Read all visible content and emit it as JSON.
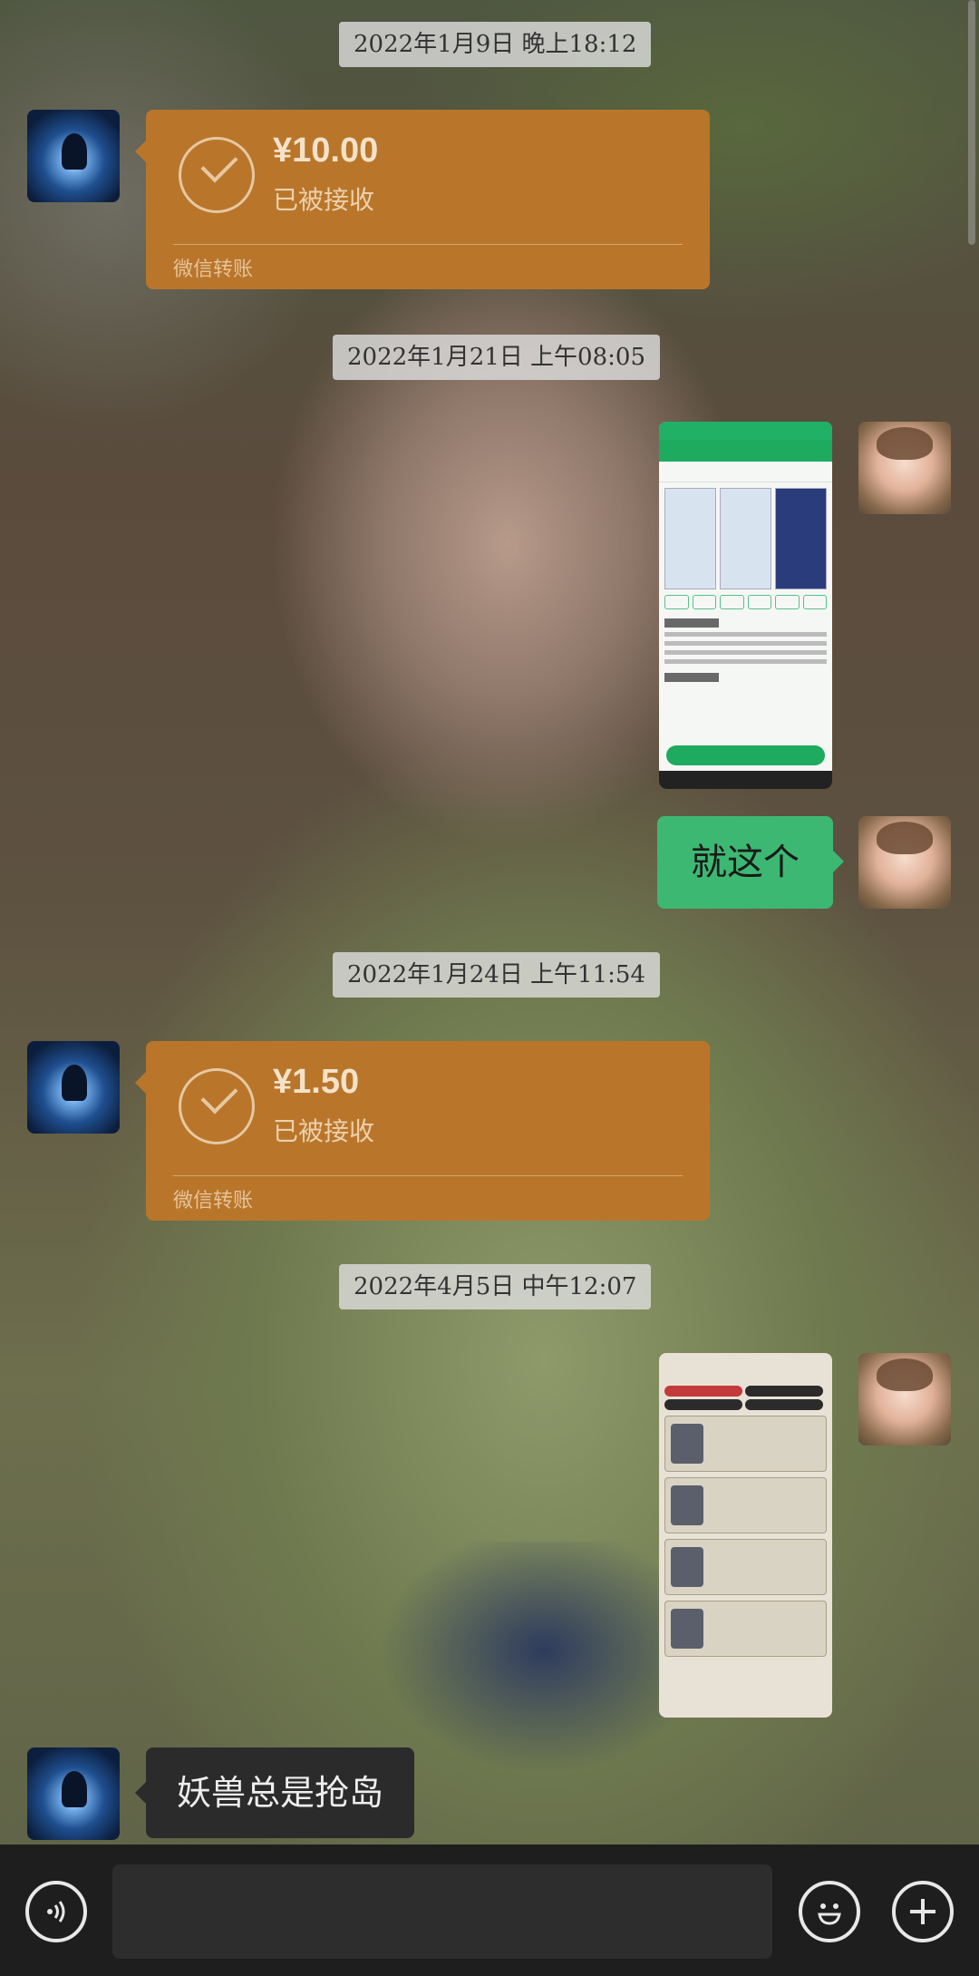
{
  "timestamps": [
    "2022年1月9日 晚上18:12",
    "2022年1月21日 上午08:05",
    "2022年1月24日 上午11:54",
    "2022年4月5日 中午12:07"
  ],
  "transfers": [
    {
      "amount": "¥10.00",
      "status": "已被接收",
      "source": "微信转账"
    },
    {
      "amount": "¥1.50",
      "status": "已被接收",
      "source": "微信转账"
    }
  ],
  "messages": {
    "outgoing_text": "就这个",
    "incoming_text": "妖兽总是抢岛"
  },
  "colors": {
    "transfer_bubble": "#b9762b",
    "outgoing_bubble": "#3db873",
    "incoming_bubble": "#2b2b2b",
    "input_bar": "#1e1e1e"
  },
  "icons": {
    "voice": "voice-icon",
    "emoji": "emoji-icon",
    "plus": "plus-icon",
    "check": "check-icon"
  },
  "input": {
    "value": "",
    "placeholder": ""
  }
}
